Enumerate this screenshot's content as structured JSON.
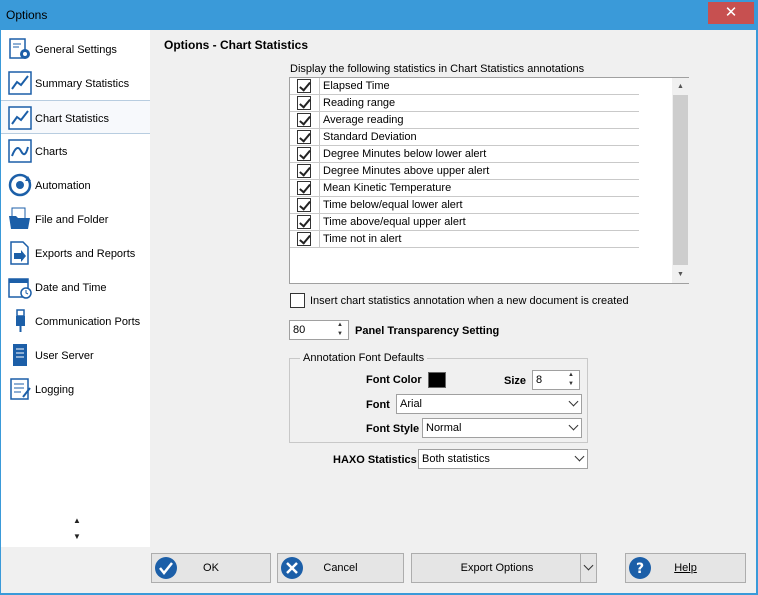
{
  "window": {
    "title": "Options",
    "close_glyph": "✕"
  },
  "sidebar": {
    "items": [
      {
        "label": "General Settings",
        "icon": "gear-document-icon"
      },
      {
        "label": "Summary Statistics",
        "icon": "line-chart-icon"
      },
      {
        "label": "Chart Statistics",
        "icon": "line-chart-icon",
        "active": true
      },
      {
        "label": "Charts",
        "icon": "chart-icon"
      },
      {
        "label": "Automation",
        "icon": "automation-icon"
      },
      {
        "label": "File and Folder",
        "icon": "folder-icon"
      },
      {
        "label": "Exports and Reports",
        "icon": "export-icon"
      },
      {
        "label": "Date and Time",
        "icon": "calendar-icon"
      },
      {
        "label": "Communication Ports",
        "icon": "usb-icon"
      },
      {
        "label": "User Server",
        "icon": "server-icon"
      },
      {
        "label": "Logging",
        "icon": "log-icon"
      }
    ],
    "scroll_up": "▲",
    "scroll_down": "▼"
  },
  "main": {
    "heading": "Options - Chart Statistics",
    "list_caption": "Display the following statistics in Chart Statistics annotations",
    "statistics": [
      {
        "label": "Elapsed Time",
        "checked": true
      },
      {
        "label": "Reading range",
        "checked": true
      },
      {
        "label": "Average reading",
        "checked": true
      },
      {
        "label": "Standard Deviation",
        "checked": true
      },
      {
        "label": "Degree Minutes below lower alert",
        "checked": true
      },
      {
        "label": "Degree Minutes above upper alert",
        "checked": true
      },
      {
        "label": "Mean Kinetic Temperature",
        "checked": true
      },
      {
        "label": "Time below/equal lower alert",
        "checked": true
      },
      {
        "label": "Time above/equal upper alert",
        "checked": true
      },
      {
        "label": "Time not in alert",
        "checked": true
      }
    ],
    "scroll_up": "▲",
    "scroll_down": "▼",
    "insert_annotation_label": "Insert chart statistics annotation when a new document is created",
    "insert_annotation_checked": false,
    "transparency": {
      "value": "80",
      "label": "Panel Transparency Setting"
    },
    "font_defaults": {
      "title": "Annotation Font Defaults",
      "font_color_label": "Font Color",
      "font_color": "#000000",
      "size_label": "Size",
      "size_value": "8",
      "font_label": "Font",
      "font_value": "Arial",
      "font_style_label": "Font Style",
      "font_style_value": "Normal"
    },
    "haxo": {
      "label": "HAXO Statistics",
      "value": "Both statistics"
    }
  },
  "footer": {
    "ok_label": "OK",
    "cancel_label": "Cancel",
    "export_label": "Export Options",
    "help_label": "Help"
  },
  "colors": {
    "title_bar": "#3a9ad9",
    "close_button": "#c75050",
    "accent_blue": "#1c5fa8"
  }
}
